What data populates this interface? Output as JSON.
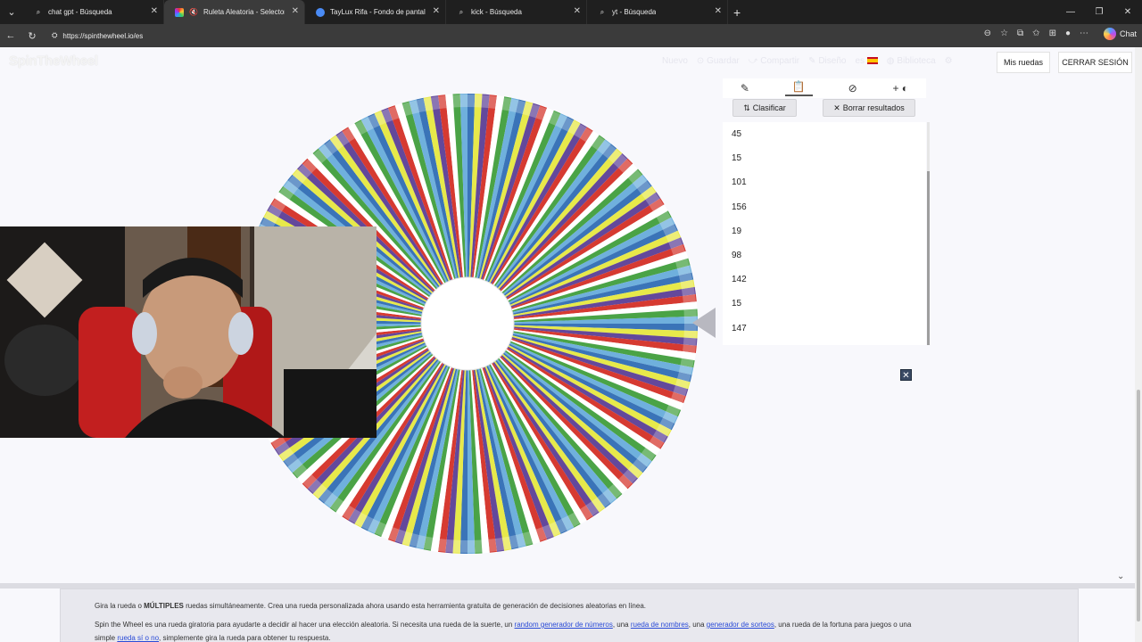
{
  "browser": {
    "tabs": [
      {
        "label": "chat gpt - Búsqueda",
        "icon": "search-icon",
        "active": false
      },
      {
        "label": "Ruleta Aleatoria - Selector Pe",
        "icon": "spinwheel-favicon",
        "active": true,
        "muted_icon": "speaker-muted-icon"
      },
      {
        "label": "TayLux Rifa - Fondo de pantalla p",
        "icon": "chrome-icon",
        "active": false
      },
      {
        "label": "kick - Búsqueda",
        "icon": "search-icon",
        "active": false
      },
      {
        "label": "yt - Búsqueda",
        "icon": "search-icon",
        "active": false
      }
    ],
    "url": "https://spinthewheel.io/es",
    "copilot_label": "Chat"
  },
  "header": {
    "logo_text": "SpinTheWheel",
    "nav": [
      "Nuevo",
      "Guardar",
      "Compartir",
      "Diseño",
      "es",
      "Biblioteca"
    ],
    "my_wheels": "Mis ruedas",
    "logout": "CERRAR SESIÓN"
  },
  "results_panel": {
    "sort_label": "Clasificar",
    "clear_label": "Borrar resultados",
    "items": [
      "45",
      "15",
      "101",
      "156",
      "19",
      "98",
      "142",
      "15",
      "147"
    ]
  },
  "wheel": {
    "segment_colors": [
      "#3a74b8",
      "#e7e94a",
      "#63489b",
      "#d63a31",
      "#ffffff",
      "#4aa346",
      "#6fb0dd"
    ]
  },
  "footer": {
    "line1_a": "Gira la rueda o ",
    "line1_b": "MÚLTIPLES",
    "line1_c": " ruedas simultáneamente. Crea una rueda personalizada ahora usando esta herramienta gratuita de generación de decisiones aleatorias en línea.",
    "line2_a": "Spin the Wheel es una rueda giratoria para ayudarte a decidir al hacer una elección aleatoria. Si necesita una rueda de la suerte, un ",
    "link1": "random generador de números",
    "line2_b": ", una ",
    "link2": "rueda de nombres",
    "line2_c": ", una ",
    "link3": "generador de sorteos",
    "line2_d": ", una rueda de la fortuna para juegos o una",
    "line3_a": "simple ",
    "link4": "rueda sí o no",
    "line3_b": ", simplemente gira la rueda para obtener tu respuesta."
  }
}
